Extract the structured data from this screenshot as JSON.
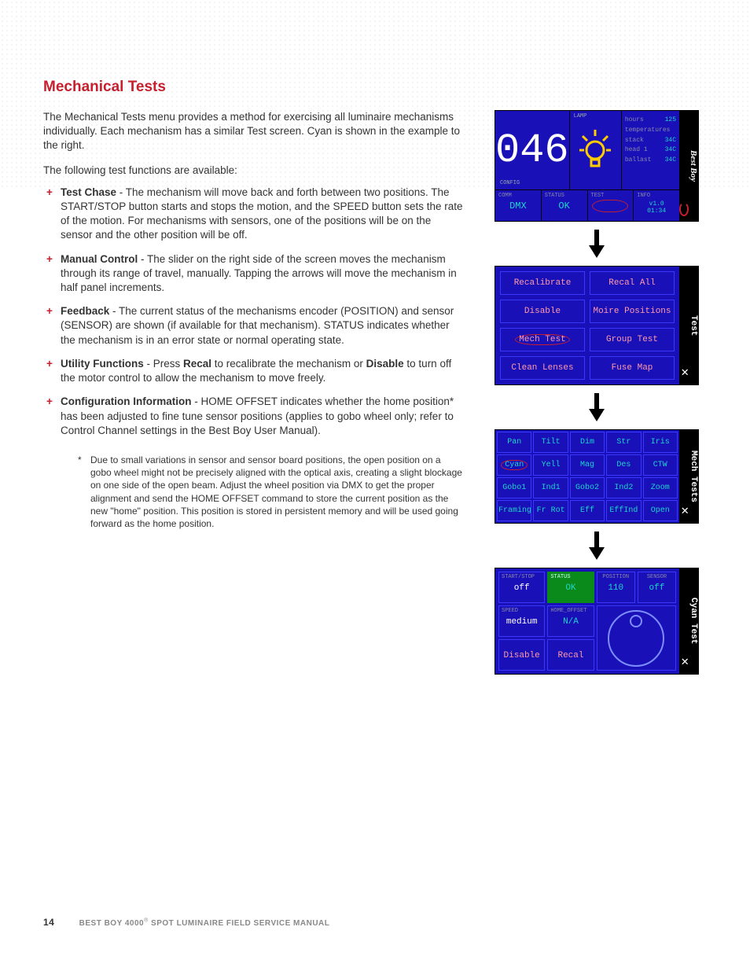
{
  "heading": "Mechanical Tests",
  "intro": "The Mechanical Tests menu provides a method for exercising all luminaire mechanisms individually. Each mechanism has a similar Test screen. Cyan is shown in the example to the right.",
  "avail": "The following test functions are available:",
  "bullets": [
    {
      "title": "Test Chase",
      "body": " - The mechanism will move back and forth between two positions. The START/STOP button starts and stops the motion, and the SPEED button sets the rate of the motion. For mechanisms with sensors, one of the positions will be on the sensor and the other position will be off."
    },
    {
      "title": "Manual Control",
      "body": " - The slider on the right side of the screen moves the mechanism through its range of travel, manually. Tapping the arrows will move the mechanism in half panel increments."
    },
    {
      "title": "Feedback",
      "body": " - The current status of the mechanisms encoder (POSITION) and sensor (SENSOR) are shown (if available for that mechanism). STATUS indicates whether the mechanism is in an error state or normal operating state."
    },
    {
      "title": "Utility Functions",
      "body_html": " - Press <b>Recal</b> to recalibrate the mechanism or <b>Disable</b> to turn off the motor control to allow the mechanism to move freely."
    },
    {
      "title": "Configuration Information",
      "body": " - HOME OFFSET indicates whether the home position* has been adjusted to fine tune sensor positions (applies to gobo wheel only; refer to Control Channel settings in the Best Boy User Manual)."
    }
  ],
  "footnote": "Due to small variations in sensor and sensor board positions, the open position on a gobo wheel might not be precisely aligned with the optical axis, creating a slight blockage on one side of the open beam. Adjust the wheel position via DMX to get the proper alignment and send the HOME OFFSET command to store the current position as the new \"home\" position. This position is stored in persistent memory and will be used going forward as the home position.",
  "footer": {
    "page": "14",
    "title": "BEST BOY 4000",
    "reg": "®",
    "sub": " SPOT LUMINAIRE FIELD SERVICE MANUAL"
  },
  "screen1": {
    "num": "046",
    "config": "CONFIG",
    "lamp_label": "LAMP",
    "info": [
      {
        "k": "hours",
        "v": "125"
      },
      {
        "k": "temperatures",
        "v": ""
      },
      {
        "k": "stack",
        "v": "34C"
      },
      {
        "k": "head 1",
        "v": "34C"
      },
      {
        "k": "ballast",
        "v": "34C"
      }
    ],
    "bottom": [
      {
        "lbl": "COMM",
        "val": "DMX"
      },
      {
        "lbl": "STATUS",
        "val": "OK"
      },
      {
        "lbl": "TEST",
        "val": ""
      },
      {
        "lbl": "INFO",
        "val": "v1.0\n01:34"
      }
    ],
    "brand": "Best Boy"
  },
  "screen2": {
    "title": "Test",
    "buttons": [
      "Recalibrate",
      "Recal All",
      "Disable",
      "Moire Positions",
      "Mech Test",
      "Group Test",
      "Clean Lenses",
      "Fuse Map"
    ]
  },
  "screen3": {
    "title": "Mech Tests",
    "buttons": [
      "Pan",
      "Tilt",
      "Dim",
      "Str",
      "Iris",
      "Cyan",
      "Yell",
      "Mag",
      "Des",
      "CTW",
      "Gobo1",
      "Ind1",
      "Gobo2",
      "Ind2",
      "Zoom",
      "Framing",
      "Fr Rot",
      "Eff",
      "EffInd",
      "Open"
    ]
  },
  "screen4": {
    "title": "Cyan Test",
    "cells": {
      "start_stop": {
        "lbl": "START/STOP",
        "val": "off"
      },
      "status": {
        "lbl": "STATUS",
        "val": "OK"
      },
      "position": {
        "lbl": "POSITION",
        "val": "110"
      },
      "sensor": {
        "lbl": "SENSOR",
        "val": "off"
      },
      "speed": {
        "lbl": "SPEED",
        "val": "medium"
      },
      "home_off": {
        "lbl": "HOME_OFFSET",
        "val": "N/A"
      },
      "disable": {
        "val": "Disable"
      },
      "recal": {
        "val": "Recal"
      }
    }
  }
}
